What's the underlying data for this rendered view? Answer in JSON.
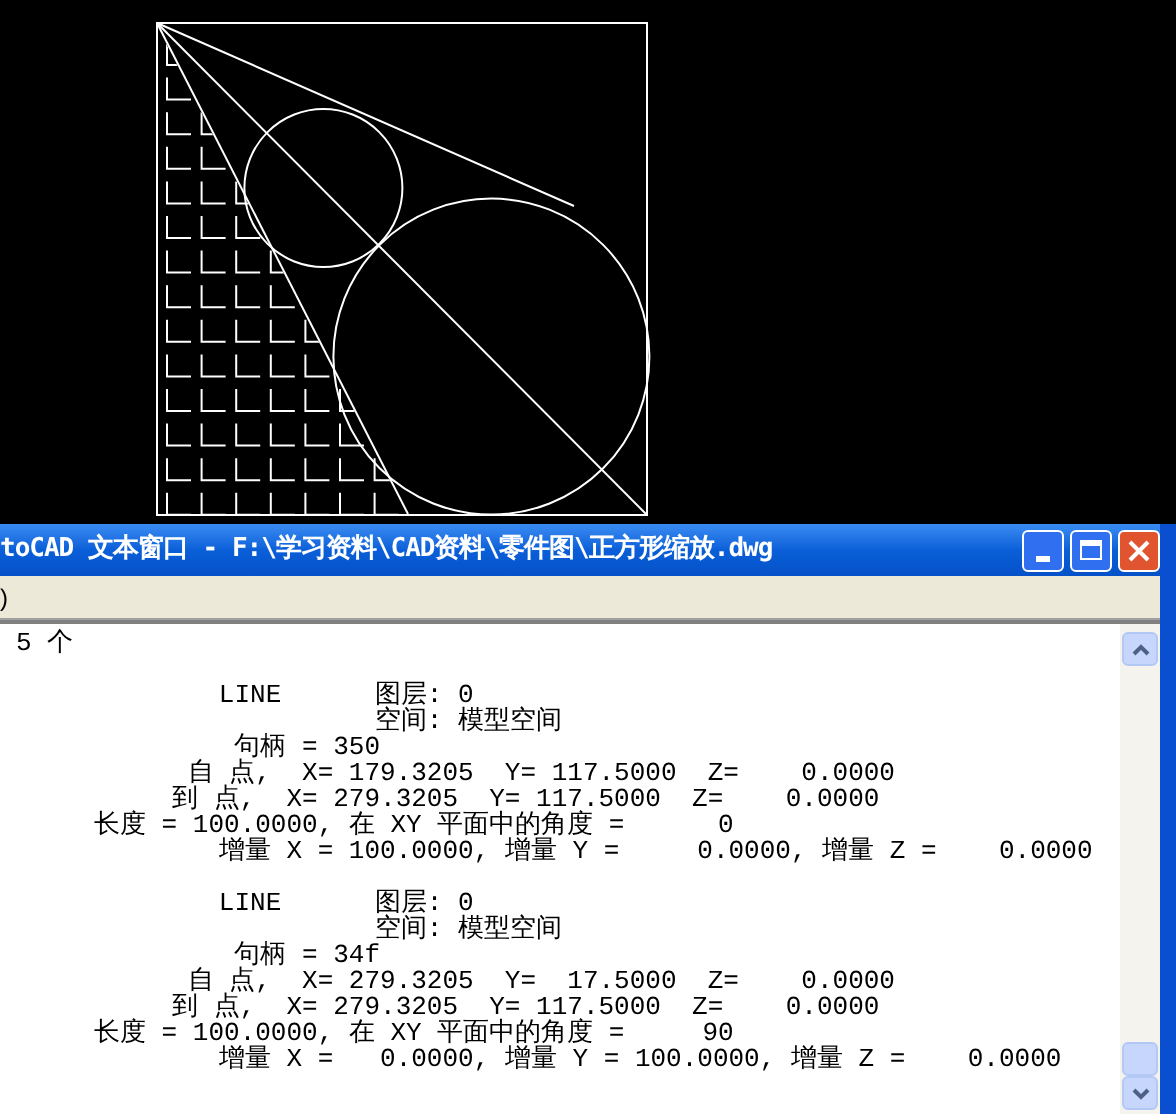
{
  "text_window": {
    "title": "toCAD 文本窗口 - F:\\学习资料\\CAD资料\\零件图\\正方形缩放.dwg",
    "menu_label": ")",
    "output_blocks": [
      {
        "lines": [
          "5 个"
        ]
      },
      {
        "lines": [
          "             LINE      图层: 0",
          "                       空间: 模型空间",
          "              句柄 = 350",
          "           自 点,  X= 179.3205  Y= 117.5000  Z=    0.0000",
          "          到 点,  X= 279.3205  Y= 117.5000  Z=    0.0000",
          "     长度 = 100.0000, 在 XY 平面中的角度 =      0",
          "             增量 X = 100.0000, 增量 Y =     0.0000, 增量 Z =    0.0000"
        ]
      },
      {
        "lines": [
          "             LINE      图层: 0",
          "                       空间: 模型空间",
          "              句柄 = 34f",
          "           自 点,  X= 279.3205  Y=  17.5000  Z=    0.0000",
          "          到 点,  X= 279.3205  Y= 117.5000  Z=    0.0000",
          "     长度 = 100.0000, 在 XY 平面中的角度 =     90",
          "             增量 X =   0.0000, 增量 Y = 100.0000, 增量 Z =    0.0000"
        ]
      }
    ]
  }
}
